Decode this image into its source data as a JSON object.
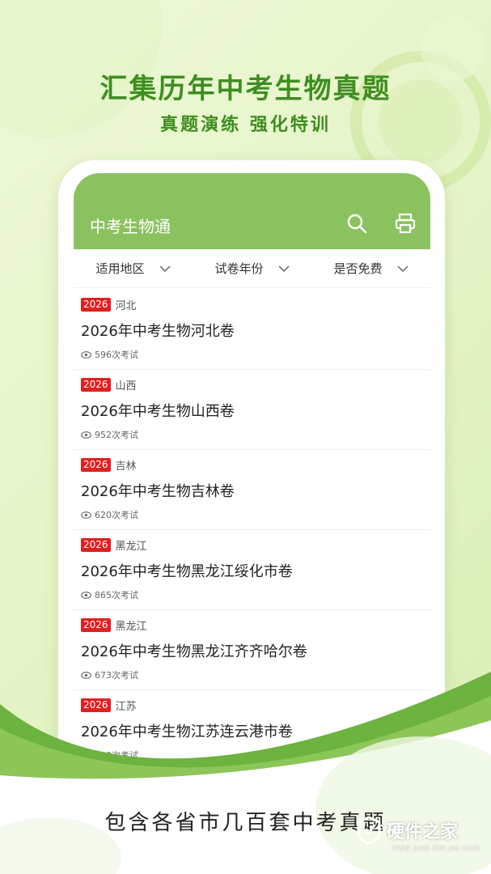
{
  "hero": {
    "title": "汇集历年中考生物真题",
    "subtitle": "真题演练  强化特训"
  },
  "app": {
    "title": "中考生物通",
    "search_icon": "search-icon",
    "print_icon": "printer-icon"
  },
  "filters": [
    {
      "label": "适用地区"
    },
    {
      "label": "试卷年份"
    },
    {
      "label": "是否免费"
    }
  ],
  "exams": [
    {
      "year": "2026",
      "region": "河北",
      "title": "2026年中考生物河北卷",
      "count": "596次考试"
    },
    {
      "year": "2026",
      "region": "山西",
      "title": "2026年中考生物山西卷",
      "count": "952次考试"
    },
    {
      "year": "2026",
      "region": "吉林",
      "title": "2026年中考生物吉林卷",
      "count": "620次考试"
    },
    {
      "year": "2026",
      "region": "黑龙江",
      "title": "2026年中考生物黑龙江绥化市卷",
      "count": "865次考试"
    },
    {
      "year": "2026",
      "region": "黑龙江",
      "title": "2026年中考生物黑龙江齐齐哈尔卷",
      "count": "673次考试"
    },
    {
      "year": "2026",
      "region": "江苏",
      "title": "2026年中考生物江苏连云港市卷",
      "count": "739次考试"
    }
  ],
  "footer": {
    "text": "包含各省市几百套中考真题"
  },
  "watermark": {
    "name": "硬件之家",
    "url": "YING JIAN ZHI JIA.COM"
  },
  "colors": {
    "accent": "#3e8e1f",
    "header": "#8bc260",
    "tag": "#e02020"
  }
}
